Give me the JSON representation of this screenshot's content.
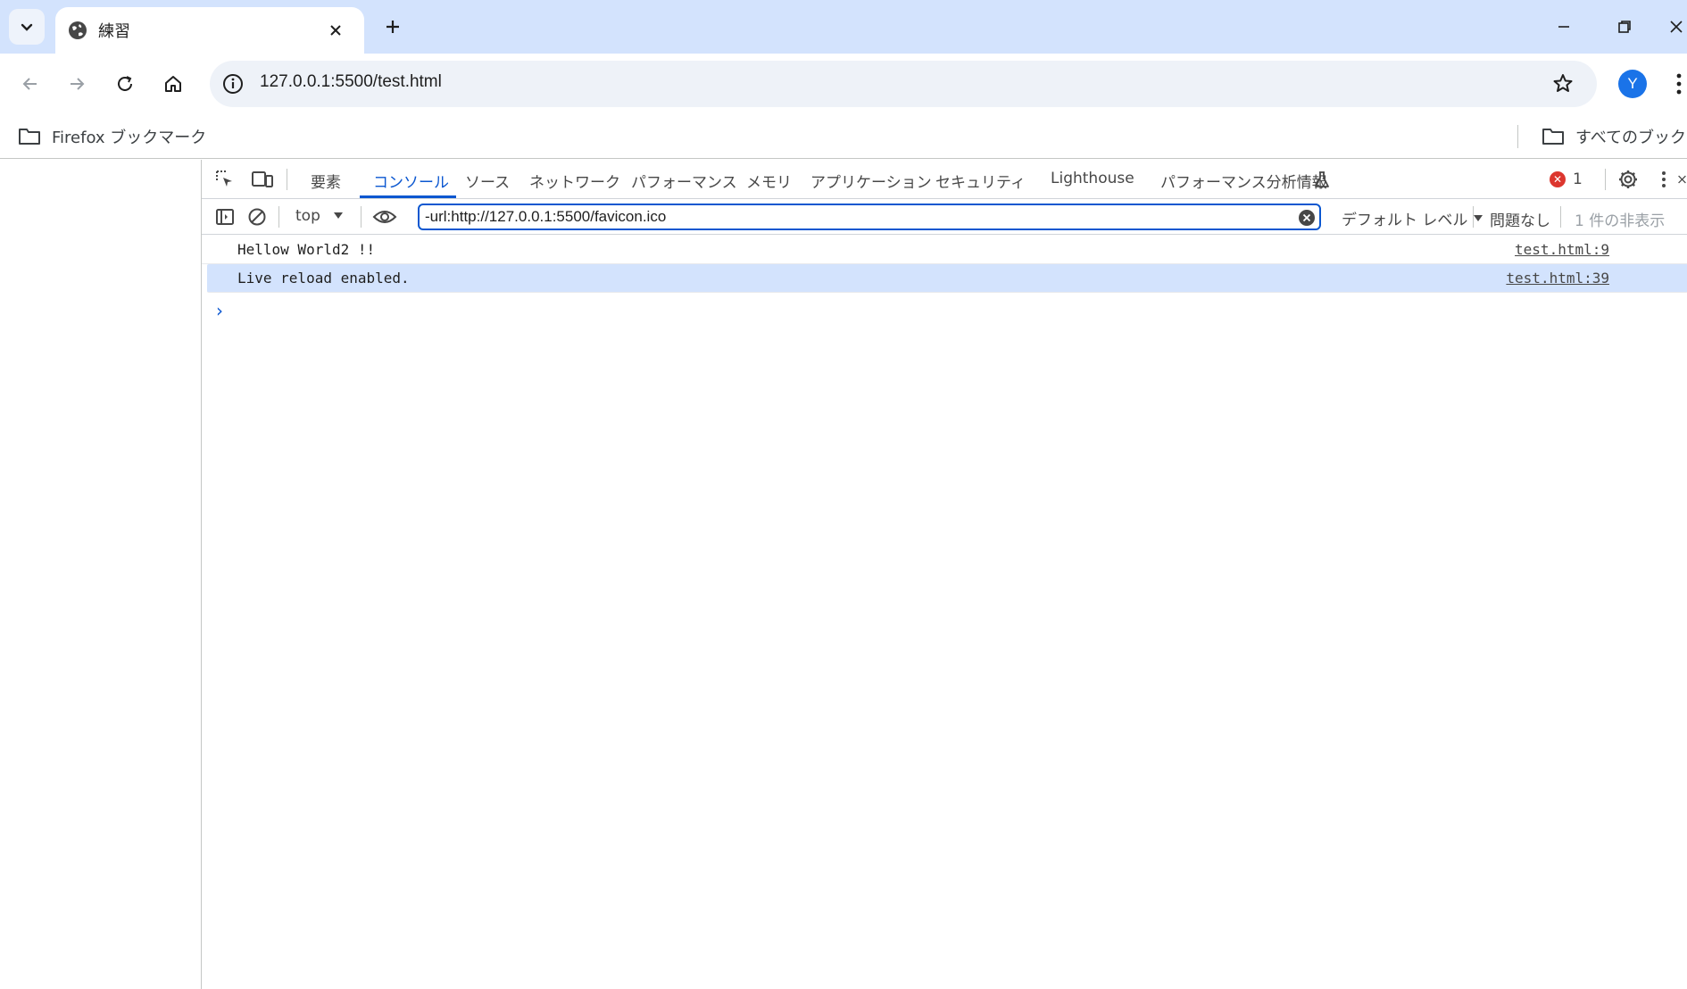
{
  "browser": {
    "tab": {
      "title": "練習"
    },
    "url": "127.0.0.1:5500/test.html",
    "avatar_letter": "Y",
    "bookmarks": [
      {
        "label": "Firefox ブックマーク"
      },
      {
        "label": "すべてのブックマーク"
      }
    ]
  },
  "devtools": {
    "tabs": [
      {
        "label": "要素"
      },
      {
        "label": "コンソール"
      },
      {
        "label": "ソース"
      },
      {
        "label": "ネットワーク"
      },
      {
        "label": "パフォーマンス"
      },
      {
        "label": "メモリ"
      },
      {
        "label": "アプリケーション"
      },
      {
        "label": "セキュリティ"
      },
      {
        "label": "Lighthouse"
      },
      {
        "label": "パフォーマンス分析情報"
      }
    ],
    "error_count": "1",
    "filterbar": {
      "context": "top",
      "filter_value": "-url:http://127.0.0.1:5500/favicon.ico",
      "level": "デフォルト レベル",
      "issues": "問題なし",
      "hidden": "1 件の非表示"
    },
    "messages": [
      {
        "text": "Hellow World2 !!",
        "source": "test.html:9"
      },
      {
        "text": "Live reload enabled.",
        "source": "test.html:39"
      }
    ]
  },
  "colors": {
    "accent": "#0b57d0",
    "tabstrip": "#d3e3fd",
    "error": "#dc362e"
  }
}
